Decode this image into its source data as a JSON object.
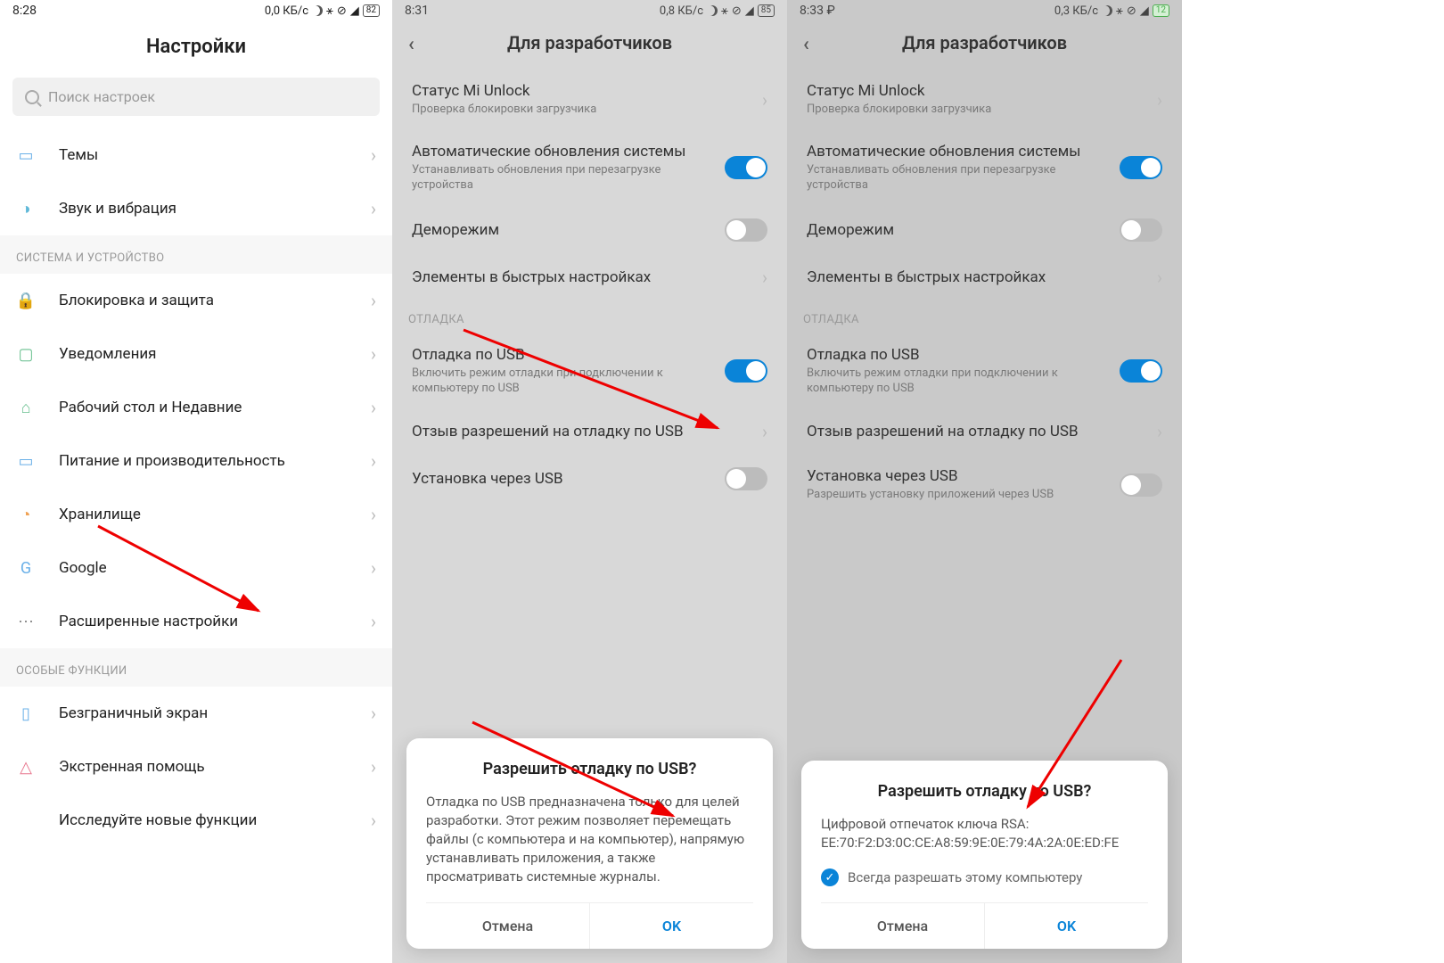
{
  "pane1": {
    "status": {
      "time": "8:28",
      "net": "0,0 КБ/с",
      "batt": "82"
    },
    "title": "Настройки",
    "search_placeholder": "Поиск настроек",
    "items_top": [
      {
        "label": "Темы",
        "icon": "themes"
      },
      {
        "label": "Звук и вибрация",
        "icon": "sound"
      }
    ],
    "section1": "СИСТЕМА И УСТРОЙСТВО",
    "items_sys": [
      {
        "label": "Блокировка и защита",
        "icon": "lock"
      },
      {
        "label": "Уведомления",
        "icon": "notif"
      },
      {
        "label": "Рабочий стол и Недавние",
        "icon": "home"
      },
      {
        "label": "Питание и производительность",
        "icon": "battery"
      },
      {
        "label": "Хранилище",
        "icon": "storage"
      },
      {
        "label": "Google",
        "icon": "google"
      },
      {
        "label": "Расширенные настройки",
        "icon": "dots"
      }
    ],
    "section2": "ОСОБЫЕ ФУНКЦИИ",
    "items_feat": [
      {
        "label": "Безграничный экран",
        "icon": "screen"
      },
      {
        "label": "Экстренная помощь",
        "icon": "sos"
      },
      {
        "label": "Исследуйте новые функции",
        "icon": ""
      }
    ]
  },
  "pane2": {
    "status": {
      "time": "8:31",
      "net": "0,8 КБ/с",
      "batt": "85"
    },
    "title": "Для разработчиков",
    "items": [
      {
        "title": "Статус Mi Unlock",
        "sub": "Проверка блокировки загрузчика",
        "type": "chev"
      },
      {
        "title": "Автоматические обновления системы",
        "sub": "Устанавливать обновления при перезагрузке устройства",
        "type": "toggle",
        "on": true
      },
      {
        "title": "Деморежим",
        "type": "toggle",
        "on": false
      },
      {
        "title": "Элементы в быстрых настройках",
        "type": "chev"
      }
    ],
    "section": "ОТЛАДКА",
    "items2": [
      {
        "title": "Отладка по USB",
        "sub": "Включить режим отладки при подключении к компьютеру по USB",
        "type": "toggle",
        "on": true
      },
      {
        "title": "Отзыв разрешений на отладку по USB",
        "type": "chev"
      },
      {
        "title": "Установка через USB",
        "type": "toggle",
        "on": false
      }
    ],
    "dialog": {
      "title": "Разрешить отладку по USB?",
      "body": "Отладка по USB предназначена только для целей разработки. Этот режим позволяет перемещать файлы (с компьютера и на компьютер), напрямую устанавливать приложения, а также просматривать системные журналы.",
      "cancel": "Отмена",
      "ok": "OK"
    }
  },
  "pane3": {
    "status": {
      "time": "8:33",
      "extra": "₽",
      "net": "0,3 КБ/с",
      "batt": "12"
    },
    "title": "Для разработчиков",
    "items": [
      {
        "title": "Статус Mi Unlock",
        "sub": "Проверка блокировки загрузчика",
        "type": "chev"
      },
      {
        "title": "Автоматические обновления системы",
        "sub": "Устанавливать обновления при перезагрузке устройства",
        "type": "toggle",
        "on": true
      },
      {
        "title": "Деморежим",
        "type": "toggle",
        "on": false
      },
      {
        "title": "Элементы в быстрых настройках",
        "type": "chev"
      }
    ],
    "section": "ОТЛАДКА",
    "items2": [
      {
        "title": "Отладка по USB",
        "sub": "Включить режим отладки при подключении к компьютеру по USB",
        "type": "toggle",
        "on": true
      },
      {
        "title": "Отзыв разрешений на отладку по USB",
        "type": "chev"
      },
      {
        "title": "Установка через USB",
        "sub": "Разрешить установку приложений через USB",
        "type": "toggle",
        "on": false
      }
    ],
    "dialog": {
      "title": "Разрешить отладку по USB?",
      "body_line1": "Цифровой отпечаток ключа RSA:",
      "body_line2": "EE:70:F2:D3:0C:CE:A8:59:9E:0E:79:4A:2A:0E:ED:FE",
      "check": "Всегда разрешать этому компьютеру",
      "cancel": "Отмена",
      "ok": "OK"
    }
  }
}
